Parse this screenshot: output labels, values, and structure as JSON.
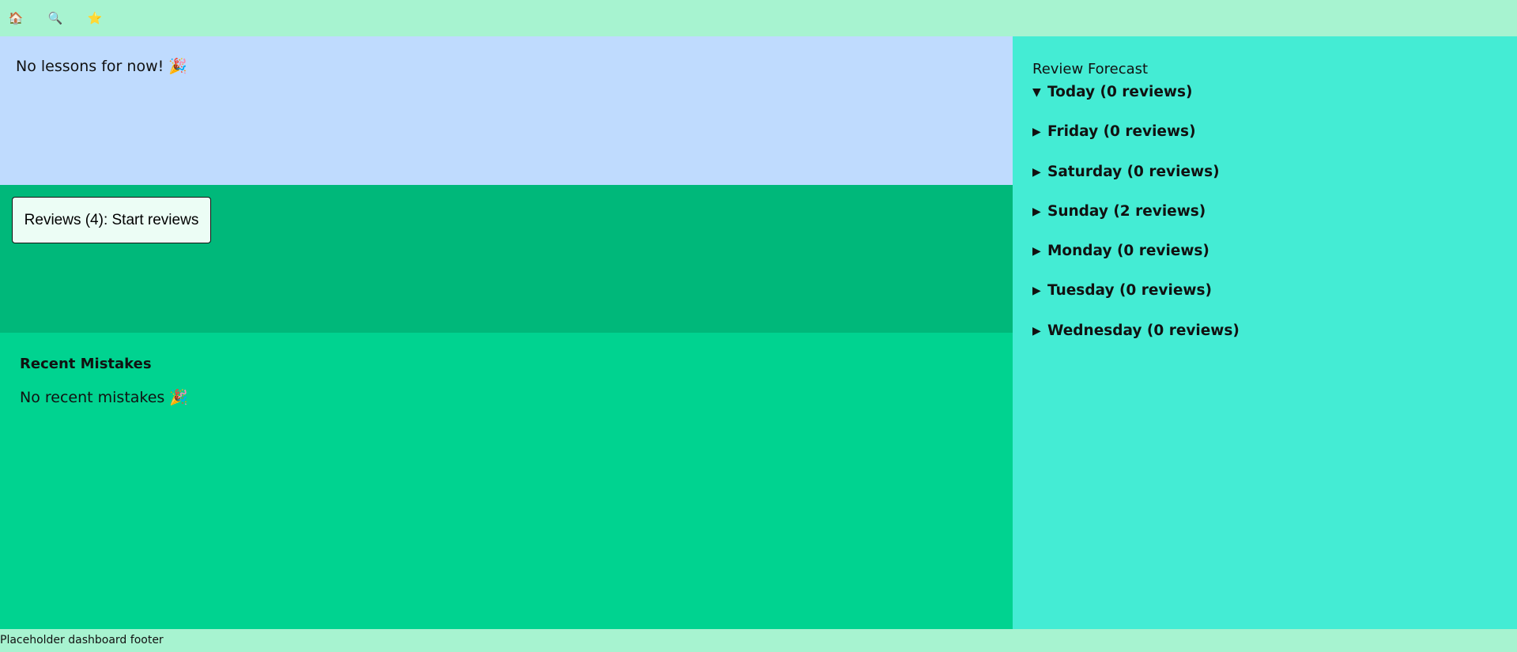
{
  "nav": {
    "items": [
      {
        "icon": "home-icon",
        "glyph": "🏠"
      },
      {
        "icon": "search-icon",
        "glyph": "🔍"
      },
      {
        "icon": "star-icon",
        "glyph": "⭐"
      }
    ]
  },
  "lessons": {
    "message": "No lessons for now! 🎉"
  },
  "reviews": {
    "button_label": "Reviews (4): Start reviews"
  },
  "mistakes": {
    "title": "Recent Mistakes",
    "empty_message": "No recent mistakes 🎉"
  },
  "forecast": {
    "title": "Review Forecast",
    "days": [
      {
        "label": "Today (0 reviews)",
        "expanded": true
      },
      {
        "label": "Friday (0 reviews)",
        "expanded": false
      },
      {
        "label": "Saturday (0 reviews)",
        "expanded": false
      },
      {
        "label": "Sunday (2 reviews)",
        "expanded": false
      },
      {
        "label": "Monday (0 reviews)",
        "expanded": false
      },
      {
        "label": "Tuesday (0 reviews)",
        "expanded": false
      },
      {
        "label": "Wednesday (0 reviews)",
        "expanded": false
      }
    ],
    "arrow_expanded": "▼",
    "arrow_collapsed": "▶"
  },
  "footer": {
    "text": "Placeholder dashboard footer"
  },
  "colors": {
    "header_bg": "#a7f3d0",
    "lessons_bg": "#bfdbfe",
    "reviews_bg": "#00b87a",
    "mistakes_bg": "#00d390",
    "forecast_bg": "#44ecd4",
    "button_bg": "#ecfdf5"
  }
}
